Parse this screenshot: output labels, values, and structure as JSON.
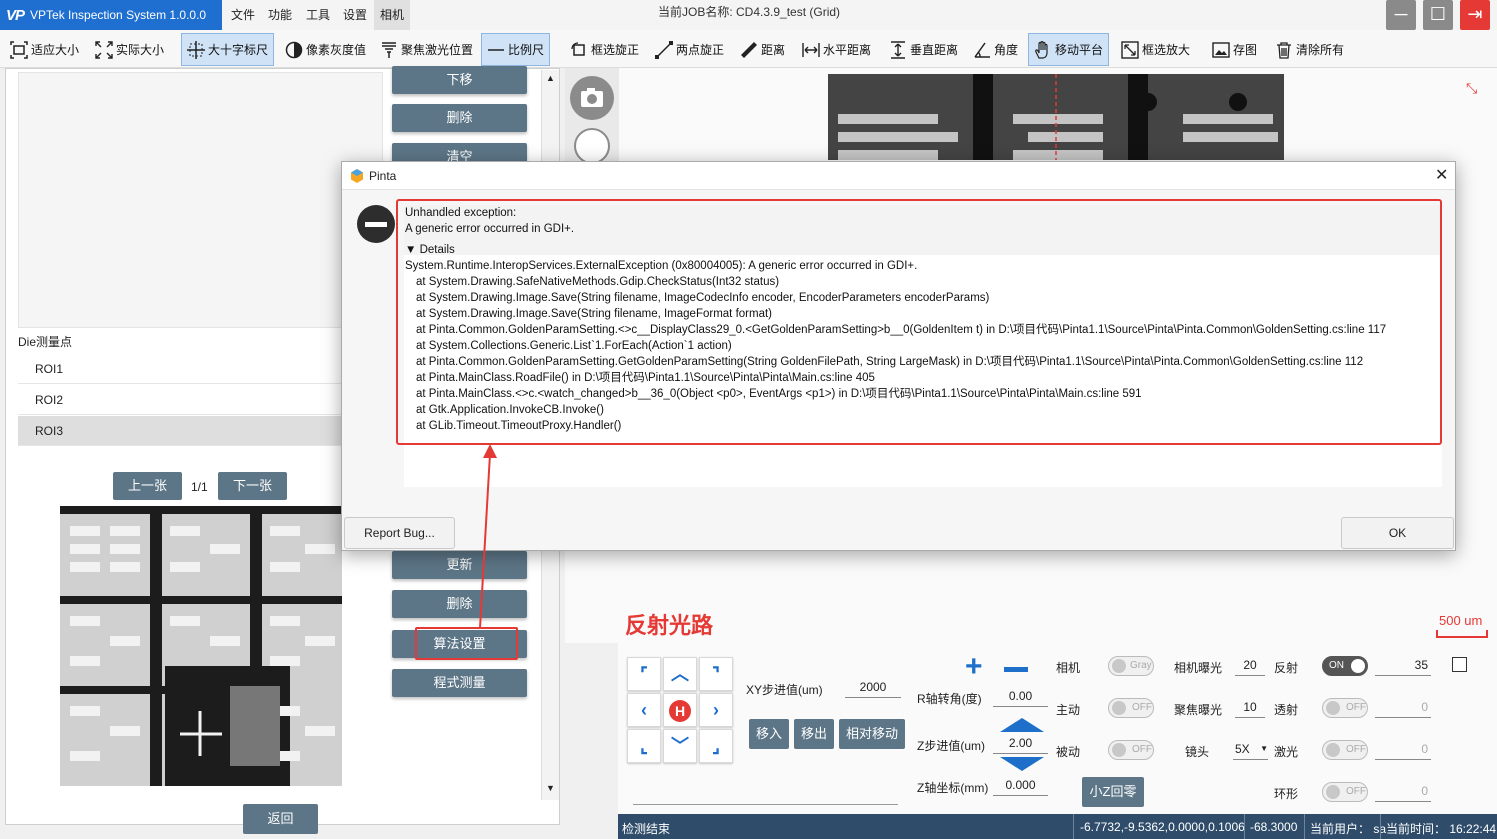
{
  "app": {
    "title": "VPTek Inspection System 1.0.0.0",
    "logo": "VP"
  },
  "menu": [
    "文件",
    "功能",
    "工具",
    "设置",
    "相机"
  ],
  "job_title": "当前JOB名称:  CD4.3.9_test (Grid)",
  "toolbar": [
    {
      "label": "适应大小",
      "icon": "fit-icon"
    },
    {
      "label": "实际大小",
      "icon": "actual-size-icon"
    },
    {
      "label": "大十字标尺",
      "icon": "crosshair-icon",
      "active": true
    },
    {
      "label": "像素灰度值",
      "icon": "grayscale-icon"
    },
    {
      "label": "聚焦激光位置",
      "icon": "laser-icon"
    },
    {
      "label": "比例尺",
      "icon": "scale-icon",
      "active": true
    },
    {
      "label": "框选旋正",
      "icon": "rotate-box-icon"
    },
    {
      "label": "两点旋正",
      "icon": "two-point-icon"
    },
    {
      "label": "距离",
      "icon": "ruler-icon"
    },
    {
      "label": "水平距离",
      "icon": "horizontal-distance-icon"
    },
    {
      "label": "垂直距离",
      "icon": "vertical-distance-icon"
    },
    {
      "label": "角度",
      "icon": "angle-icon"
    },
    {
      "label": "移动平台",
      "icon": "hand-icon",
      "active": true
    },
    {
      "label": "框选放大",
      "icon": "zoom-box-icon"
    },
    {
      "label": "存图",
      "icon": "save-image-icon"
    },
    {
      "label": "清除所有",
      "icon": "trash-icon"
    }
  ],
  "left": {
    "buttons_top": [
      "下移",
      "删除",
      "清空"
    ],
    "section_label": "Die测量点",
    "rois": [
      "ROI1",
      "ROI2",
      "ROI3"
    ],
    "selected_roi": "ROI3",
    "prev": "上一张",
    "page": "1/1",
    "next": "下一张",
    "buttons_bottom": [
      "更新",
      "删除",
      "算法设置",
      "程式测量"
    ],
    "back": "返回"
  },
  "dialog": {
    "title": "Pinta",
    "message1": "Unhandled exception:",
    "message2": "A generic error occurred in GDI+.",
    "details_label": "Details",
    "trace": [
      "System.Runtime.InteropServices.ExternalException (0x80004005): A generic error occurred in GDI+.",
      "   at System.Drawing.SafeNativeMethods.Gdip.CheckStatus(Int32 status)",
      "   at System.Drawing.Image.Save(String filename, ImageCodecInfo encoder, EncoderParameters encoderParams)",
      "   at System.Drawing.Image.Save(String filename, ImageFormat format)",
      "   at Pinta.Common.GoldenParamSetting.<>c__DisplayClass29_0.<GetGoldenParamSetting>b__0(GoldenItem t) in D:\\项目代码\\Pinta1.1\\Source\\Pinta\\Pinta.Common\\GoldenSetting.cs:line 117",
      "   at System.Collections.Generic.List`1.ForEach(Action`1 action)",
      "   at Pinta.Common.GoldenParamSetting.GetGoldenParamSetting(String GoldenFilePath, String LargeMask) in D:\\项目代码\\Pinta1.1\\Source\\Pinta\\Pinta.Common\\GoldenSetting.cs:line 112",
      "   at Pinta.MainClass.RoadFile() in D:\\项目代码\\Pinta1.1\\Source\\Pinta\\Pinta\\Main.cs:line 405",
      "   at Pinta.MainClass.<>c.<watch_changed>b__36_0(Object <p0>, EventArgs <p1>) in D:\\项目代码\\Pinta1.1\\Source\\Pinta\\Pinta\\Main.cs:line 591",
      "   at Gtk.Application.InvokeCB.Invoke()",
      "   at GLib.Timeout.TimeoutProxy.Handler()"
    ],
    "report_bug": "Report Bug...",
    "ok": "OK"
  },
  "viewer": {
    "path_label": "反射光路",
    "scale_label": "500 um"
  },
  "controls": {
    "xy_step_label": "XY步进值(um)",
    "xy_step": "2000",
    "r_angle_label": "R轴转角(度)",
    "r_angle": "0.00",
    "z_step_label": "Z步进值(um)",
    "z_step": "2.00",
    "z_coord_label": "Z轴坐标(mm)",
    "z_coord": "0.000",
    "move_in": "移入",
    "move_out": "移出",
    "relative_move": "相对移动",
    "small_z_home": "小Z回零",
    "home": "H",
    "camera_label": "相机",
    "camera_toggle": "Gray",
    "active_label": "主动",
    "active_toggle": "OFF",
    "passive_label": "被动",
    "passive_toggle": "OFF",
    "cam_exposure_label": "相机曝光",
    "cam_exposure": "20",
    "focus_exposure_label": "聚焦曝光",
    "focus_exposure": "10",
    "lens_label": "镜头",
    "lens": "5X",
    "reflect_label": "反射",
    "reflect_toggle": "ON",
    "reflect_value": "35",
    "transmit_label": "透射",
    "transmit_toggle": "OFF",
    "transmit_value": "0",
    "laser_label": "激光",
    "laser_toggle": "OFF",
    "laser_value": "0",
    "ring_label": "环形",
    "ring_toggle": "OFF",
    "ring_value": "0"
  },
  "status": {
    "left": "检测结束",
    "coords": "-6.7732,-9.5362,0.0000,0.1006",
    "value": "-68.3000",
    "user": "当前用户：  sa",
    "time": "当前时间：  16:22:44"
  },
  "colors": {
    "brand": "#1f6fd1",
    "annotation": "#e53935",
    "status_bar": "#2f4d6a",
    "button": "#5d7687"
  }
}
